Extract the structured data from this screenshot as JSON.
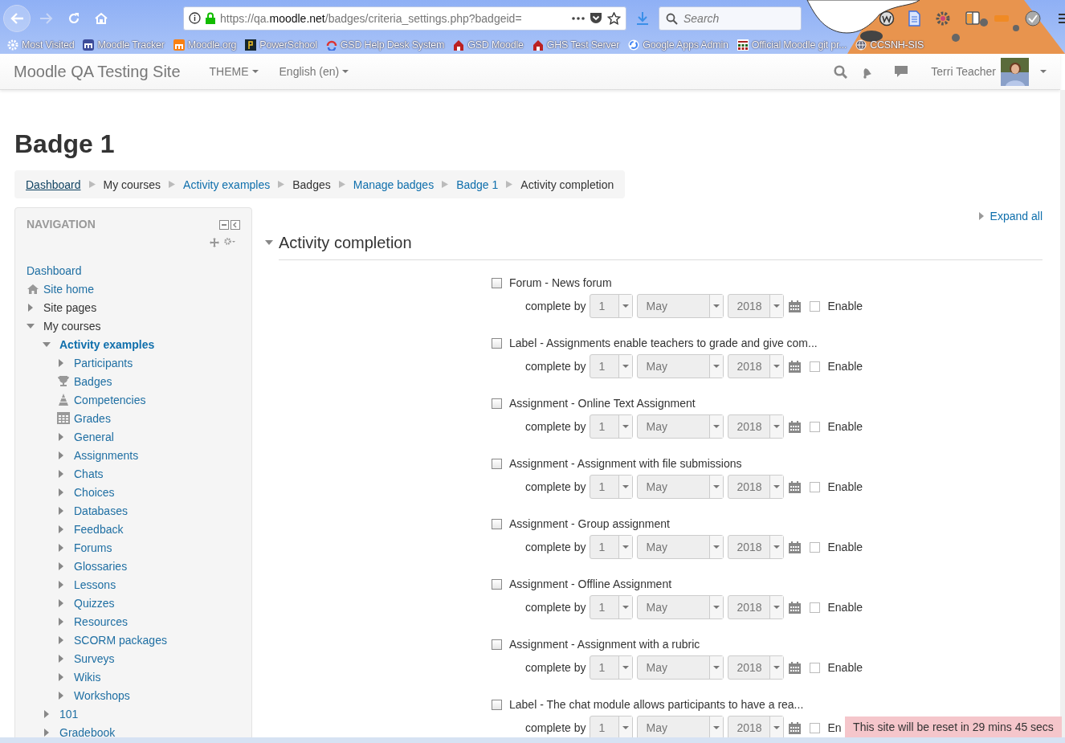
{
  "browser": {
    "url": {
      "before": "https://qa.",
      "host": "moodle.net",
      "after": "/badges/criteria_settings.php?badgeid="
    },
    "search": {
      "placeholder": "Search"
    },
    "bookmarks": [
      {
        "label": "Most Visited",
        "kind": "gear"
      },
      {
        "label": "Moodle Tracker",
        "kind": "tracker"
      },
      {
        "label": "Moodle.org",
        "kind": "moodle"
      },
      {
        "label": "PowerSchool",
        "kind": "powerschool"
      },
      {
        "label": "GSD Help Desk System",
        "kind": "helpdesk"
      },
      {
        "label": "GSD Moodle",
        "kind": "school"
      },
      {
        "label": "GHS Test Server",
        "kind": "school"
      },
      {
        "label": "Google Apps Admin",
        "kind": "google"
      },
      {
        "label": "Official Moodle git pr...",
        "kind": "grid"
      },
      {
        "label": "CCSNH-SIS",
        "kind": "globe"
      }
    ]
  },
  "header": {
    "site_name": "Moodle QA Testing Site",
    "menus": [
      "THEME",
      "English (en)"
    ],
    "user": "Terri Teacher"
  },
  "page_title": "Badge 1",
  "breadcrumb": [
    {
      "label": "Dashboard",
      "kind": "link",
      "hovered": true
    },
    {
      "label": "My courses",
      "kind": "text",
      "hovered": false
    },
    {
      "label": "Activity examples",
      "kind": "link",
      "hovered": false
    },
    {
      "label": "Badges",
      "kind": "text",
      "hovered": false
    },
    {
      "label": "Manage badges",
      "kind": "link",
      "hovered": false
    },
    {
      "label": "Badge 1",
      "kind": "link",
      "hovered": false
    },
    {
      "label": "Activity completion",
      "kind": "text",
      "hovered": false
    }
  ],
  "navigation": {
    "title": "NAVIGATION",
    "items": [
      {
        "label": "Dashboard",
        "kind": "link"
      },
      {
        "label": "Site home",
        "kind": "home"
      },
      {
        "label": "Site pages",
        "kind": "category",
        "expanded": false
      },
      {
        "label": "My courses",
        "kind": "category",
        "expanded": true,
        "children": [
          {
            "label": "Activity examples",
            "kind": "course",
            "expanded": true,
            "current": true,
            "children": [
              {
                "label": "Participants",
                "kind": "branch",
                "expanded": false
              },
              {
                "label": "Badges",
                "kind": "badges"
              },
              {
                "label": "Competencies",
                "kind": "competencies"
              },
              {
                "label": "Grades",
                "kind": "grades"
              },
              {
                "label": "General",
                "kind": "branch",
                "expanded": false
              },
              {
                "label": "Assignments",
                "kind": "branch",
                "expanded": false
              },
              {
                "label": "Chats",
                "kind": "branch",
                "expanded": false
              },
              {
                "label": "Choices",
                "kind": "branch",
                "expanded": false
              },
              {
                "label": "Databases",
                "kind": "branch",
                "expanded": false
              },
              {
                "label": "Feedback",
                "kind": "branch",
                "expanded": false
              },
              {
                "label": "Forums",
                "kind": "branch",
                "expanded": false
              },
              {
                "label": "Glossaries",
                "kind": "branch",
                "expanded": false
              },
              {
                "label": "Lessons",
                "kind": "branch",
                "expanded": false
              },
              {
                "label": "Quizzes",
                "kind": "branch",
                "expanded": false
              },
              {
                "label": "Resources",
                "kind": "branch",
                "expanded": false
              },
              {
                "label": "SCORM packages",
                "kind": "branch",
                "expanded": false
              },
              {
                "label": "Surveys",
                "kind": "branch",
                "expanded": false
              },
              {
                "label": "Wikis",
                "kind": "branch",
                "expanded": false
              },
              {
                "label": "Workshops",
                "kind": "branch",
                "expanded": false
              }
            ]
          },
          {
            "label": "101",
            "kind": "course",
            "expanded": false,
            "current": false
          },
          {
            "label": "Gradebook",
            "kind": "course",
            "expanded": false,
            "current": false
          }
        ]
      }
    ]
  },
  "expand_all": "Expand all",
  "section": {
    "title": "Activity completion",
    "expanded": true,
    "activities": [
      {
        "label": "Forum - News forum",
        "checked": false,
        "complete_by": "complete by",
        "day": "1",
        "month": "May",
        "year": "2018",
        "enable_checked": false,
        "enable_label": "Enable"
      },
      {
        "label": "Label - Assignments enable teachers to grade and give com...",
        "checked": false,
        "complete_by": "complete by",
        "day": "1",
        "month": "May",
        "year": "2018",
        "enable_checked": false,
        "enable_label": "Enable"
      },
      {
        "label": "Assignment - Online Text Assignment",
        "checked": false,
        "complete_by": "complete by",
        "day": "1",
        "month": "May",
        "year": "2018",
        "enable_checked": false,
        "enable_label": "Enable"
      },
      {
        "label": "Assignment - Assignment with file submissions",
        "checked": false,
        "complete_by": "complete by",
        "day": "1",
        "month": "May",
        "year": "2018",
        "enable_checked": false,
        "enable_label": "Enable"
      },
      {
        "label": "Assignment - Group assignment",
        "checked": false,
        "complete_by": "complete by",
        "day": "1",
        "month": "May",
        "year": "2018",
        "enable_checked": false,
        "enable_label": "Enable"
      },
      {
        "label": "Assignment - Offline Assignment",
        "checked": false,
        "complete_by": "complete by",
        "day": "1",
        "month": "May",
        "year": "2018",
        "enable_checked": false,
        "enable_label": "Enable"
      },
      {
        "label": "Assignment - Assignment with a rubric",
        "checked": false,
        "complete_by": "complete by",
        "day": "1",
        "month": "May",
        "year": "2018",
        "enable_checked": false,
        "enable_label": "Enable"
      },
      {
        "label": "Label - The chat module allows participants to have a rea...",
        "checked": false,
        "complete_by": "complete by",
        "day": "1",
        "month": "May",
        "year": "2018",
        "enable_checked": false,
        "enable_label": "En"
      }
    ]
  },
  "reset_notice": "This site will be reset in 29 mins 45 secs"
}
